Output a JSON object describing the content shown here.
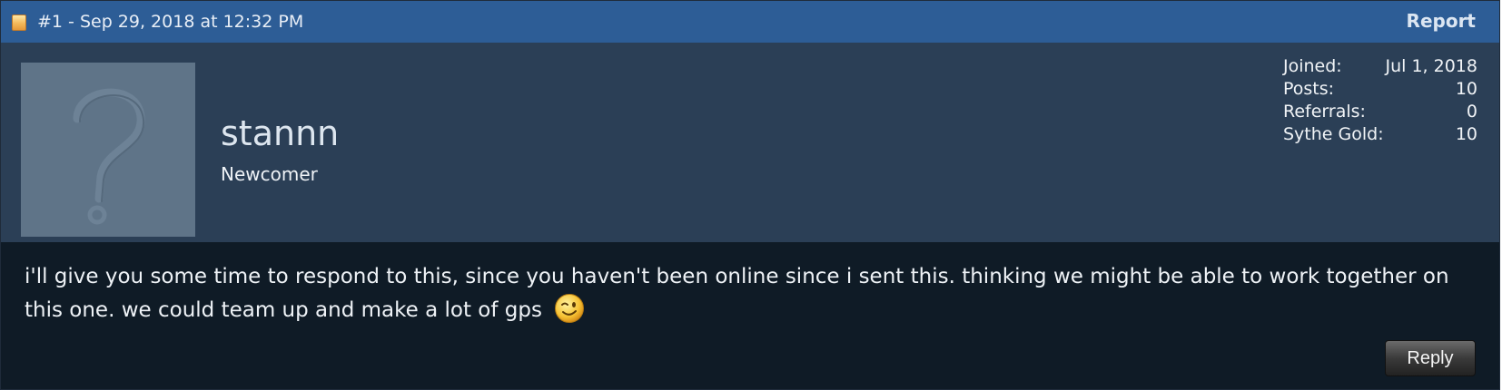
{
  "post": {
    "meta": "#1 - Sep 29, 2018 at 12:32 PM",
    "report_label": "Report"
  },
  "user": {
    "name": "stannn",
    "title": "Newcomer",
    "stats": [
      {
        "label": "Joined:",
        "value": "Jul 1, 2018"
      },
      {
        "label": "Posts:",
        "value": "10"
      },
      {
        "label": "Referrals:",
        "value": "0"
      },
      {
        "label": "Sythe Gold:",
        "value": "10"
      }
    ]
  },
  "message": {
    "text": "i'll give you some time to respond to this, since you haven't been online since i sent this. thinking we might be able to work together on this one. we could team up and make a lot of gps",
    "emoji": "wink-smiley-icon"
  },
  "actions": {
    "reply_label": "Reply"
  },
  "colors": {
    "header_bg": "#2d5d96",
    "user_band_bg": "#2b3f56",
    "body_bg": "#0f1b26"
  }
}
